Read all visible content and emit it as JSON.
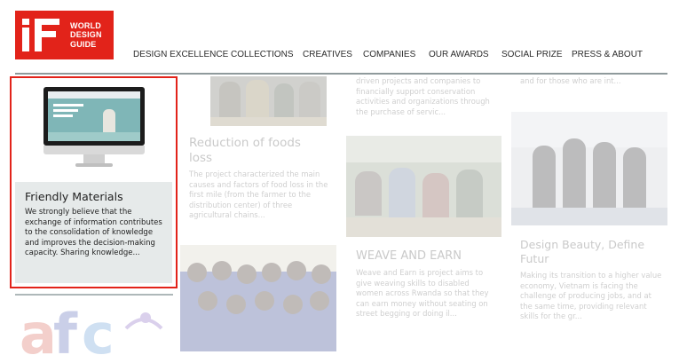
{
  "logo": {
    "line1": "WORLD",
    "line2": "DESIGN",
    "line3": "GUIDE"
  },
  "nav": [
    {
      "label": "DESIGN EXCELLENCE"
    },
    {
      "label": "COLLECTIONS"
    },
    {
      "label": "CREATIVES"
    },
    {
      "label": "COMPANIES"
    },
    {
      "label": "OUR AWARDS"
    },
    {
      "label": "SOCIAL PRIZE"
    },
    {
      "label": "PRESS & ABOUT"
    }
  ],
  "cards": {
    "featured": {
      "title": "Friendly Materials",
      "text": "We strongly believe that the exchange of information contributes to the consolidation of knowledge and improves the decision-making capacity. Sharing knowledge..."
    },
    "foods": {
      "top_text": "",
      "title": "Reduction of foods loss",
      "text": "The project characterized the main causes and factors of food loss in the first mile (from the farmer to the distribution center) of three agricultural chains..."
    },
    "conservation": {
      "text": "driven projects and companies to financially support conservation activities and organizations through the purchase of servic..."
    },
    "weave": {
      "title": "WEAVE AND EARN",
      "text": "Weave and Earn is project aims to give weaving skills to disabled women across Rwanda so that they can earn money without seating on street begging or doing il..."
    },
    "top_right": {
      "text": "and for those who are int..."
    },
    "beauty": {
      "title": "Design Beauty, Define Futur",
      "text": "Making its transition to a higher value economy, Vietnam is facing the challenge of producing jobs, and at the same time, providing relevant skills for the gr..."
    }
  },
  "colors": {
    "brand_red": "#e2231a",
    "rule_gray": "#8f9a9c",
    "card_bg": "#e6eaea"
  }
}
